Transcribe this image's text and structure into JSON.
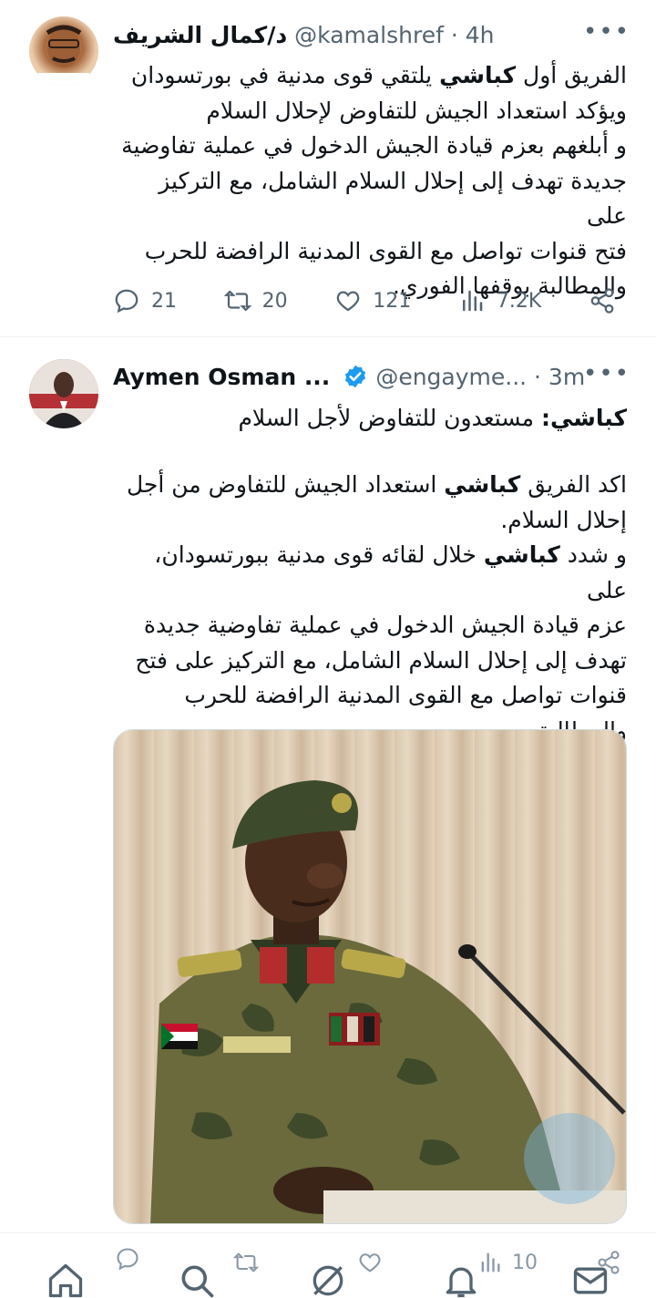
{
  "tweets": [
    {
      "name": "د/كمال الشريف",
      "handle": "@kamalshref · 4h",
      "body_html": "الفريق أول <b>كباشي</b> يلتقي قوى مدنية في بورتسودان\nويؤكد استعداد الجيش للتفاوض لإحلال السلام\nو أبلغهم بعزم قيادة الجيش الدخول في عملية تفاوضية\nجديدة تهدف إلى إحلال السلام الشامل، مع التركيز على\nفتح قنوات تواصل مع القوى المدنية الرافضة للحرب\nوالمطالبة بوقفها الفوري.",
      "replies": "21",
      "retweets": "20",
      "likes": "121",
      "views": "7.2K"
    },
    {
      "name": "Aymen Osman ...",
      "handle": "@engayme... · 3m",
      "title_html": "<b>كباشي:</b> مستعدون للتفاوض لأجل السلام",
      "body_html": "اكد الفريق <b>كباشي</b> استعداد الجيش للتفاوض من أجل\nإحلال السلام.\nو شدد <b>كباشي</b> خلال لقائه قوى مدنية ببورتسودان، على\nعزم قيادة الجيش الدخول في عملية تفاوضية جديدة\nتهدف إلى إحلال السلام الشامل، مع التركيز على فتح\nقنوات تواصل مع القوى المدنية الرافضة للحرب والمطالبة\nبوقفها الفوري.",
      "views": "10"
    }
  ],
  "icons": {
    "more": "more-icon",
    "reply": "reply-icon",
    "retweet": "retweet-icon",
    "like": "like-icon",
    "views": "views-icon",
    "share": "share-icon",
    "verified": "verified-badge-icon",
    "nav": [
      "home-icon",
      "search-icon",
      "grok-icon",
      "notifications-icon",
      "messages-icon"
    ]
  },
  "colors": {
    "text": "#0f1419",
    "muted": "#536471",
    "verified": "#1d9bf0"
  }
}
